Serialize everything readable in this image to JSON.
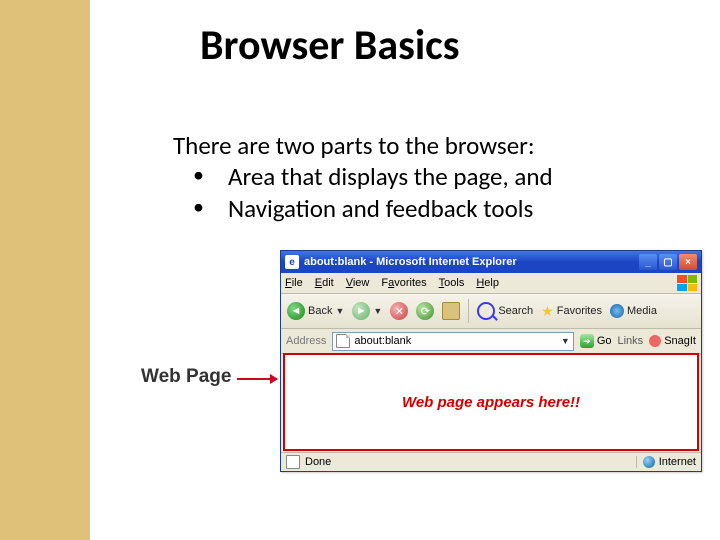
{
  "title": "Browser Basics",
  "body": {
    "intro": "There are two parts to the browser:",
    "bullets": [
      "Area that displays the page, and",
      "Navigation and feedback tools"
    ]
  },
  "figure": {
    "callout_label": "Web Page",
    "window_title": "about:blank - Microsoft Internet Explorer",
    "menus": {
      "file": "File",
      "edit": "Edit",
      "view": "View",
      "favorites": "Favorites",
      "tools": "Tools",
      "help": "Help"
    },
    "toolbar": {
      "back": "Back",
      "search": "Search",
      "favorites": "Favorites",
      "media": "Media"
    },
    "address": {
      "label": "Address",
      "value": "about:blank",
      "go": "Go",
      "links": "Links",
      "snagit": "SnagIt"
    },
    "content_text": "Web page appears here!!",
    "status": {
      "done": "Done",
      "zone": "Internet"
    }
  }
}
